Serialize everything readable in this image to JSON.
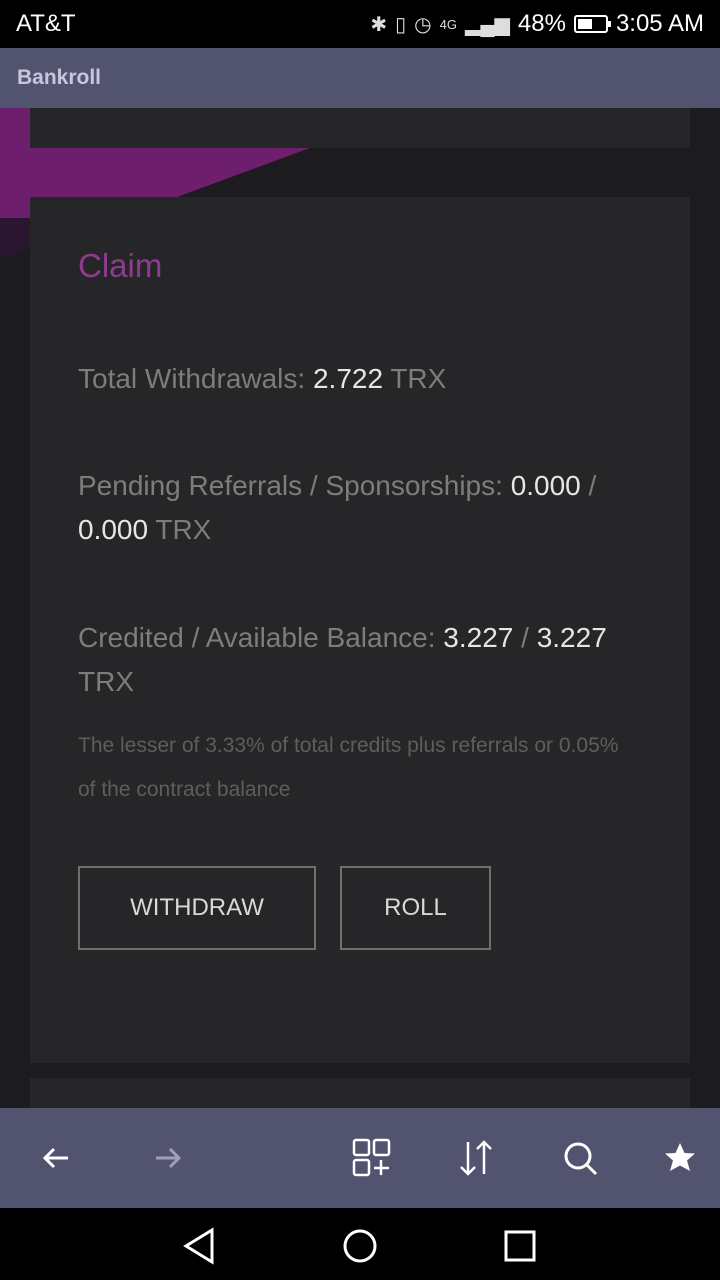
{
  "status_bar": {
    "carrier": "AT&T",
    "battery_percent": "48%",
    "time": "3:05 AM",
    "icons": [
      "bluetooth-icon",
      "vibrate-icon",
      "alarm-icon",
      "4g-lte-icon",
      "signal-icon",
      "battery-icon"
    ],
    "battery_level": 0.48
  },
  "app_bar": {
    "title": "Bankroll"
  },
  "claim_card": {
    "title": "Claim",
    "total_withdrawals": {
      "label": "Total Withdrawals: ",
      "value": "2.722",
      "unit": " TRX"
    },
    "pending": {
      "label": "Pending Referrals / Sponsorships: ",
      "value1": "0.000",
      "sep": " / ",
      "value2": "0.000",
      "unit": " TRX"
    },
    "balance": {
      "label": "Credited / Available Balance: ",
      "value1": "3.227",
      "sep": " / ",
      "value2": "3.227",
      "unit": " TRX"
    },
    "note": "The lesser of 3.33% of total credits plus referrals or 0.05% of the contract balance",
    "withdraw_label": "WITHDRAW",
    "roll_label": "ROLL"
  },
  "toolbar": {
    "icons": [
      "back-arrow-icon",
      "forward-arrow-icon",
      "tabs-add-icon",
      "sort-icon",
      "search-icon",
      "star-icon"
    ]
  },
  "nav": {
    "icons": [
      "nav-back-icon",
      "nav-home-icon",
      "nav-recents-icon"
    ]
  },
  "colors": {
    "accent": "#8d3b90",
    "app_bar": "#52536f",
    "card": "#262628",
    "background": "#1c1b1f"
  }
}
